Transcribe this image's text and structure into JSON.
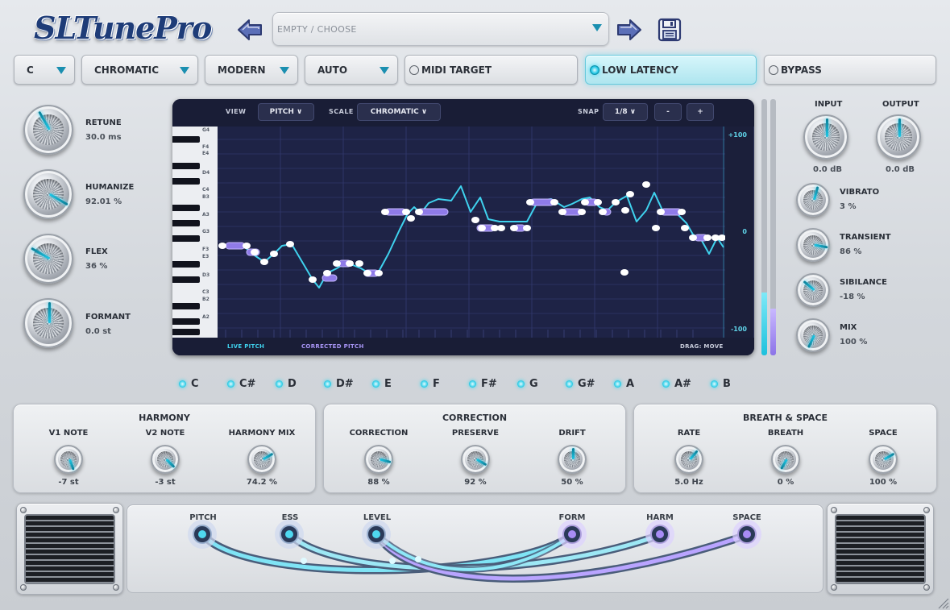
{
  "header": {
    "logo_text": "SLTunePro",
    "preset_name": "EMPTY / CHOOSE"
  },
  "top_controls": {
    "key": "C",
    "scale": "CHROMATIC",
    "mode": "MODERN",
    "auto": "AUTO",
    "midi_target": "MIDI TARGET",
    "low_latency": "LOW LATENCY",
    "bypass": "BYPASS",
    "low_latency_on": true
  },
  "left_knobs": [
    {
      "label": "RETUNE",
      "value": "30.0 ms"
    },
    {
      "label": "HUMANIZE",
      "value": "92.01 %"
    },
    {
      "label": "FLEX",
      "value": "36 %"
    },
    {
      "label": "FORMANT",
      "value": "0.0 st"
    }
  ],
  "editor": {
    "view_label": "VIEW",
    "view_value": "PITCH ∨",
    "scale_label": "SCALE",
    "scale_value": "CHROMATIC ∨",
    "snap_label": "SNAP",
    "snap_value": "1/8 ∨",
    "minus": "-",
    "plus": "+",
    "scale_top": "+100",
    "scale_mid": "0",
    "scale_bottom": "-100",
    "live_pitch": "LIVE PITCH",
    "corrected_pitch": "CORRECTED PITCH",
    "drag_hint": "DRAG: MOVE",
    "note_labels": [
      "G4",
      "F4",
      "E4",
      "D4",
      "C4",
      "B3",
      "A3",
      "G3",
      "F3",
      "E3",
      "D3",
      "C3",
      "B2",
      "A2"
    ]
  },
  "right_knobs": {
    "input_label": "INPUT",
    "input_value": "0.0 dB",
    "output_label": "OUTPUT",
    "output_value": "0.0 dB",
    "list": [
      {
        "label": "VIBRATO",
        "value": "3 %"
      },
      {
        "label": "TRANSIENT",
        "value": "86 %"
      },
      {
        "label": "SIBILANCE",
        "value": "-18 %"
      },
      {
        "label": "MIX",
        "value": "100 %"
      }
    ]
  },
  "notes": [
    "C",
    "C#",
    "D",
    "D#",
    "E",
    "F",
    "F#",
    "G",
    "G#",
    "A",
    "A#",
    "B"
  ],
  "panels": {
    "harmony": {
      "title": "HARMONY",
      "knobs": [
        {
          "label": "V1 NOTE",
          "value": "-7 st"
        },
        {
          "label": "V2 NOTE",
          "value": "-3 st"
        },
        {
          "label": "HARMONY MIX",
          "value": "74.2 %"
        }
      ]
    },
    "correction": {
      "title": "CORRECTION",
      "knobs": [
        {
          "label": "CORRECTION",
          "value": "88 %"
        },
        {
          "label": "PRESERVE",
          "value": "92 %"
        },
        {
          "label": "DRIFT",
          "value": "50 %"
        }
      ]
    },
    "breath": {
      "title": "BREATH & SPACE",
      "knobs": [
        {
          "label": "RATE",
          "value": "5.0 Hz"
        },
        {
          "label": "BREATH",
          "value": "0 %"
        },
        {
          "label": "SPACE",
          "value": "100 %"
        }
      ]
    }
  },
  "routing": {
    "jacks": [
      "PITCH",
      "ESS",
      "LEVEL",
      "FORM",
      "HARM",
      "SPACE"
    ]
  },
  "colors": {
    "accent_cyan": "#22c8e6",
    "accent_purple": "#a28bf2",
    "editor_bg": "#1b1f3a"
  },
  "icons": {
    "back": "arrow-left-icon",
    "forward": "arrow-right-icon",
    "save": "floppy-disk-icon"
  }
}
